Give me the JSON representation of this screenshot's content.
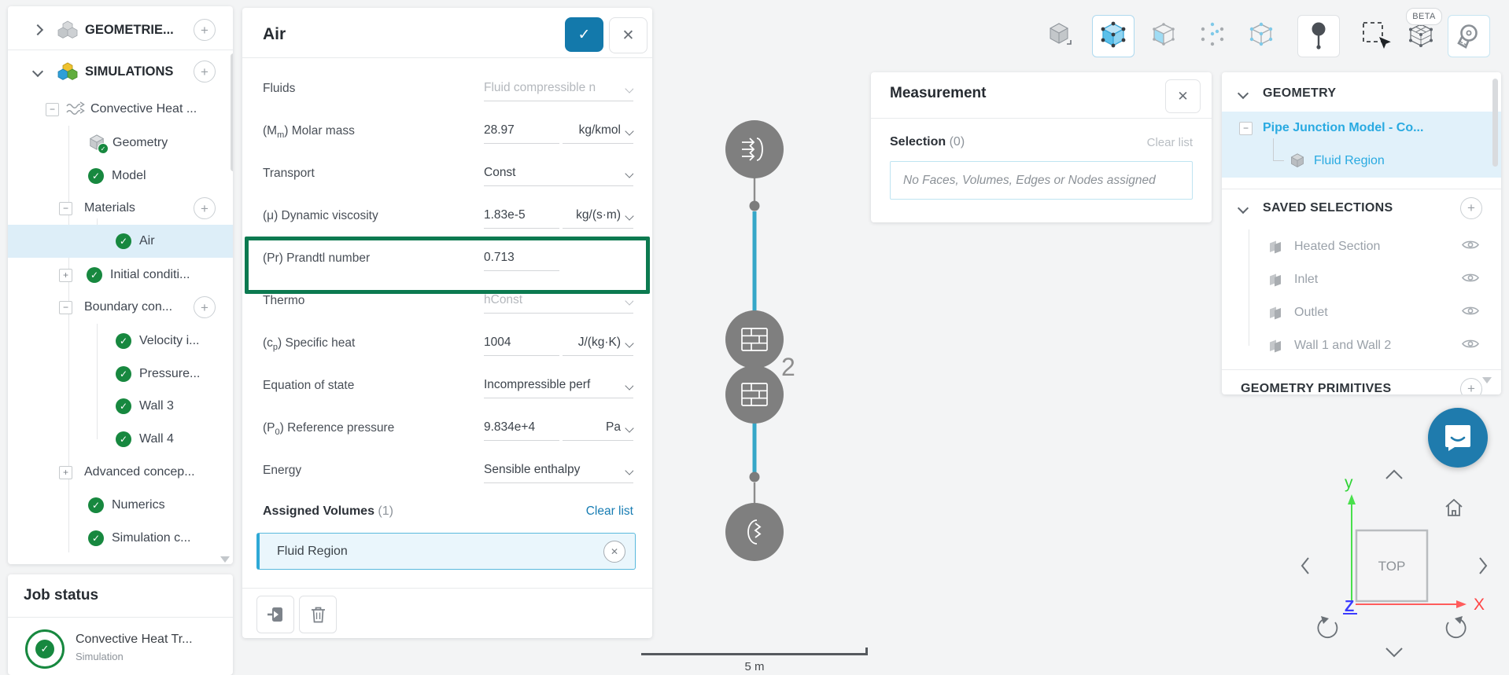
{
  "toolbar": {
    "beta_label": "BETA"
  },
  "left_tree": {
    "rows": [
      {
        "label": "GEOMETRIE..."
      },
      {
        "label": "SIMULATIONS"
      },
      {
        "label": "Convective Heat ..."
      },
      {
        "label": "Geometry"
      },
      {
        "label": "Model"
      },
      {
        "label": "Materials"
      },
      {
        "label": "Air"
      },
      {
        "label": "Initial conditi..."
      },
      {
        "label": "Boundary con..."
      },
      {
        "label": "Velocity i..."
      },
      {
        "label": "Pressure..."
      },
      {
        "label": "Wall 3"
      },
      {
        "label": "Wall 4"
      },
      {
        "label": "Advanced concep..."
      },
      {
        "label": "Numerics"
      },
      {
        "label": "Simulation c..."
      }
    ]
  },
  "job_status": {
    "title": "Job status",
    "item_name": "Convective Heat Tr...",
    "item_type": "Simulation"
  },
  "air_panel": {
    "title": "Air",
    "fields": [
      {
        "pre": "Fluids",
        "sub": "",
        "post": "",
        "value": "Fluid compressible n"
      },
      {
        "pre": "(M",
        "sub": "m",
        "post": ") Molar mass",
        "value": "28.97",
        "unit": "kg/kmol"
      },
      {
        "pre": "Transport",
        "sub": "",
        "post": "",
        "value": "Const"
      },
      {
        "pre": "(μ) Dynamic viscosity",
        "sub": "",
        "post": "",
        "value": "1.83e-5",
        "unit": "kg/(s·m)"
      },
      {
        "pre": "(Pr) Prandtl number",
        "sub": "",
        "post": "",
        "value": "0.713"
      },
      {
        "pre": "Thermo",
        "sub": "",
        "post": "",
        "value": "hConst"
      },
      {
        "pre": "(c",
        "sub": "p",
        "post": ") Specific heat",
        "value": "1004",
        "unit": "J/(kg·K)"
      },
      {
        "pre": "Equation of state",
        "sub": "",
        "post": "",
        "value": "Incompressible perf"
      },
      {
        "pre": "(P",
        "sub": "0",
        "post": ") Reference pressure",
        "value": "9.834e+4",
        "unit": "Pa"
      },
      {
        "pre": "Energy",
        "sub": "",
        "post": "",
        "value": "Sensible enthalpy"
      }
    ],
    "assigned_volumes": {
      "label": "Assigned Volumes",
      "count": "(1)",
      "clear_label": "Clear list",
      "chip": "Fluid Region"
    }
  },
  "measurement": {
    "title": "Measurement",
    "selection_label": "Selection",
    "selection_count": "(0)",
    "clear_label": "Clear list",
    "empty_text": "No Faces, Volumes, Edges or Nodes assigned"
  },
  "right_panel": {
    "geometry_header": "GEOMETRY",
    "geometry_item": "Pipe Junction Model - Co...",
    "geometry_child": "Fluid Region",
    "saved_header": "SAVED SELECTIONS",
    "saved_items": [
      {
        "label": "Heated Section"
      },
      {
        "label": "Inlet"
      },
      {
        "label": "Outlet"
      },
      {
        "label": "Wall 1 and Wall 2"
      }
    ],
    "primitives_header": "GEOMETRY PRIMITIVES"
  },
  "viewport": {
    "wall_badge_count": "2",
    "scale_label": "5 m"
  },
  "nav_cube": {
    "face_label": "TOP",
    "axis_x": "X",
    "axis_y": "y",
    "axis_z": "Z"
  },
  "colors": {
    "accent_blue": "#29aae1",
    "link_blue": "#187db3",
    "green_check": "#17883f",
    "tutorial_green": "#0c7a50",
    "pipe_blue": "#35a7c8",
    "confirm_blue": "#1379ab"
  }
}
